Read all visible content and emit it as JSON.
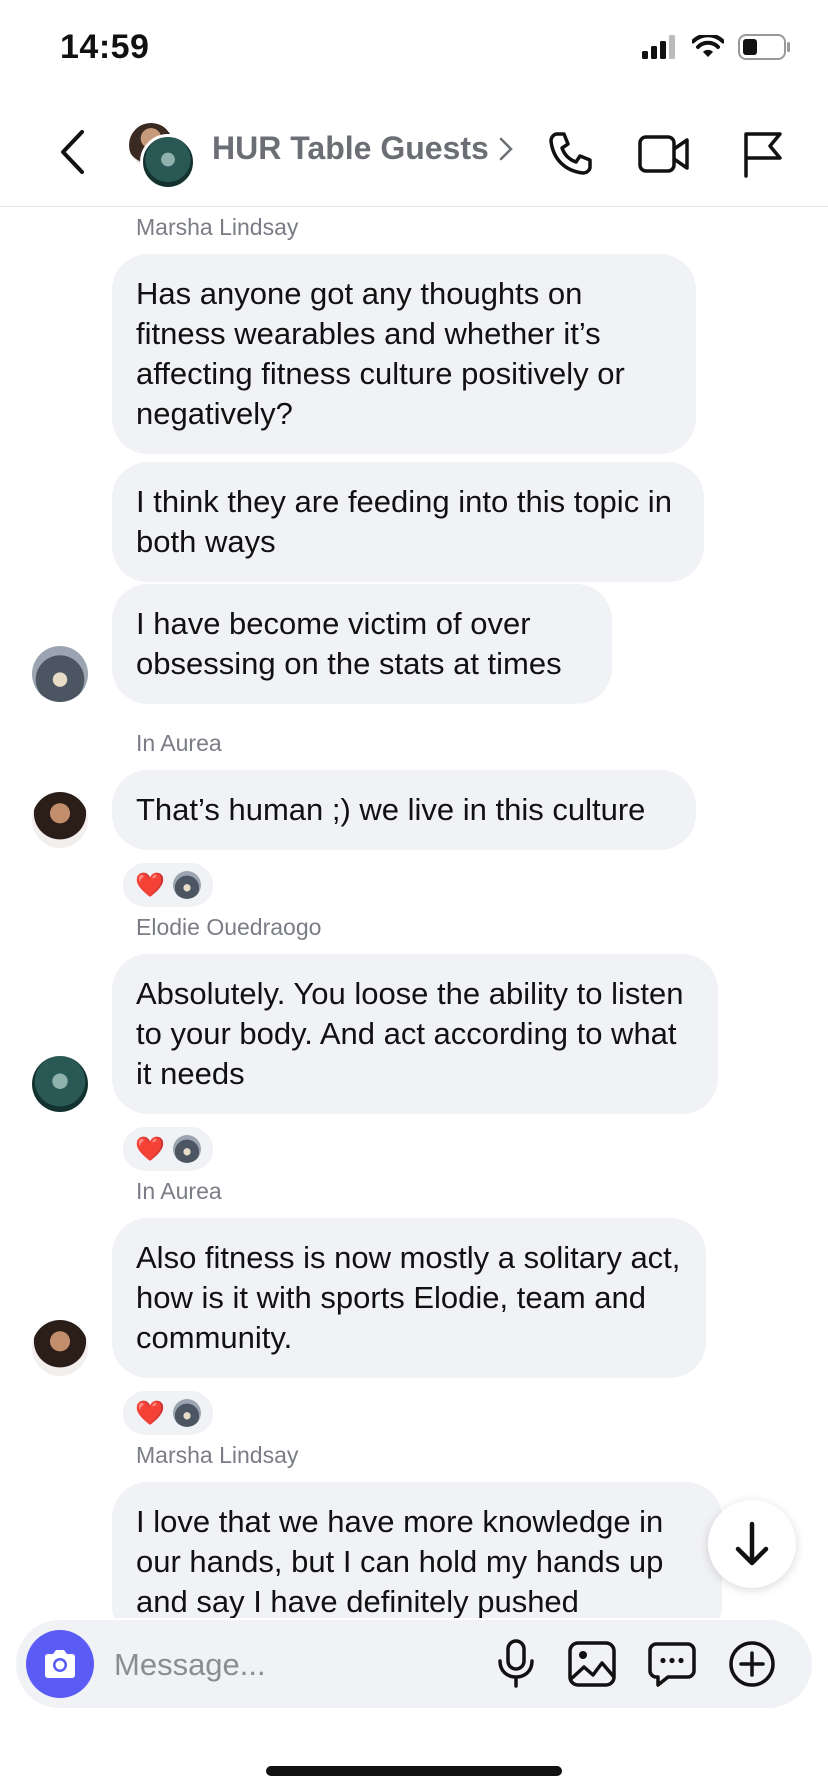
{
  "status_bar": {
    "time": "14:59"
  },
  "header": {
    "title": "HUR Table Guests"
  },
  "messages": [
    {
      "sender": "Marsha Lindsay",
      "text": "Has anyone got any thoughts on fitness wearables and whether it’s affecting fitness culture positively or negatively?"
    },
    {
      "text": "I think they are feeding into this topic in both ways"
    },
    {
      "text": "I have become victim of over obsessing on the stats at times"
    },
    {
      "sender": "In Aurea",
      "text": "That’s human ;) we live in this culture"
    },
    {
      "sender": "Elodie Ouedraogo",
      "text": "Absolutely. You loose the ability to listen to your body. And act according to what it needs"
    },
    {
      "sender": "In Aurea",
      "text": "Also fitness is now mostly a solitary act, how is it with sports Elodie, team and community."
    },
    {
      "sender": "Marsha Lindsay",
      "text": "I love that we have more knowledge in our hands, but I can hold my hands up and say I have definitely pushed"
    }
  ],
  "reactions": {
    "emoji": "❤️"
  },
  "composer": {
    "placeholder": "Message..."
  },
  "colors": {
    "accent": "#5b5bf6",
    "bubble": "#f1f2f5",
    "heart": "#e8202a"
  },
  "icons": [
    "back-chevron-icon",
    "phone-icon",
    "video-camera-icon",
    "flag-icon",
    "camera-icon",
    "microphone-icon",
    "image-icon",
    "sticker-chat-icon",
    "plus-circle-icon",
    "arrow-down-icon"
  ]
}
